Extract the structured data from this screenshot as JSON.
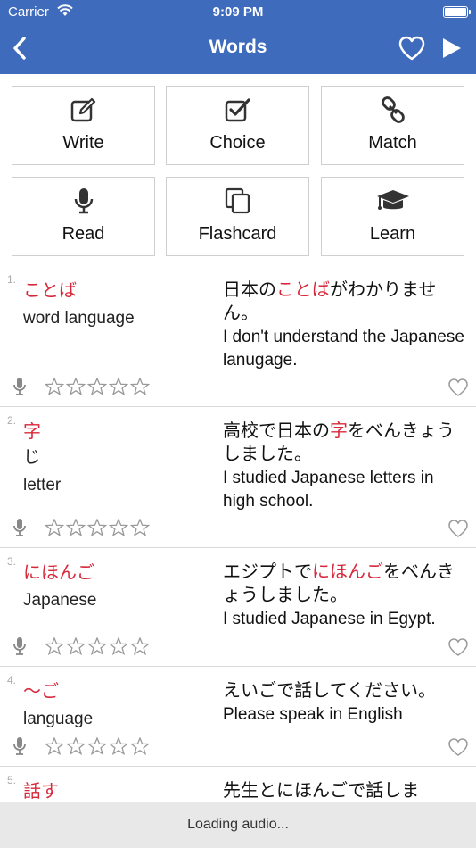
{
  "status": {
    "carrier": "Carrier",
    "time": "9:09 PM"
  },
  "nav": {
    "title": "Words",
    "back_icon": "chevron-left-icon",
    "favorite_icon": "heart-icon",
    "play_icon": "play-icon"
  },
  "modes": [
    {
      "label": "Write",
      "icon": "pencil-square-icon"
    },
    {
      "label": "Choice",
      "icon": "check-square-icon"
    },
    {
      "label": "Match",
      "icon": "link-icon"
    },
    {
      "label": "Read",
      "icon": "microphone-icon"
    },
    {
      "label": "Flashcard",
      "icon": "copy-cards-icon"
    },
    {
      "label": "Learn",
      "icon": "graduation-cap-icon"
    }
  ],
  "words": [
    {
      "num": "1.",
      "word": "ことば",
      "reading": "",
      "meaning": "word language",
      "sentence_pre": "日本の",
      "sentence_hl": "ことば",
      "sentence_post": "がわかりません。",
      "translation": "I don't understand the Japanese lanugage.",
      "rating": 0
    },
    {
      "num": "2.",
      "word": "字",
      "reading": "じ",
      "meaning": "letter",
      "sentence_pre": "高校で日本の",
      "sentence_hl": "字",
      "sentence_post": "をべんきょうしました。",
      "translation": "I studied Japanese letters in high school.",
      "rating": 0
    },
    {
      "num": "3.",
      "word": "にほんご",
      "reading": "",
      "meaning": "Japanese",
      "sentence_pre": "エジプトで",
      "sentence_hl": "にほんご",
      "sentence_post": "をべんきょうしました。",
      "translation": "I studied Japanese in Egypt.",
      "rating": 0
    },
    {
      "num": "4.",
      "word": "～ご",
      "reading": "",
      "meaning": "language",
      "sentence_pre": "えいごで話してください。",
      "sentence_hl": "",
      "sentence_post": "",
      "translation": "Please speak in English",
      "rating": 0
    },
    {
      "num": "5.",
      "word": "話す",
      "reading": "",
      "meaning": "",
      "sentence_pre": "先生とにほんごで話しま",
      "sentence_hl": "",
      "sentence_post": "",
      "translation": "",
      "rating": 0
    }
  ],
  "footer": {
    "loading": "Loading audio..."
  },
  "colors": {
    "brand": "#3f6bbd",
    "accent": "#d7283a"
  }
}
